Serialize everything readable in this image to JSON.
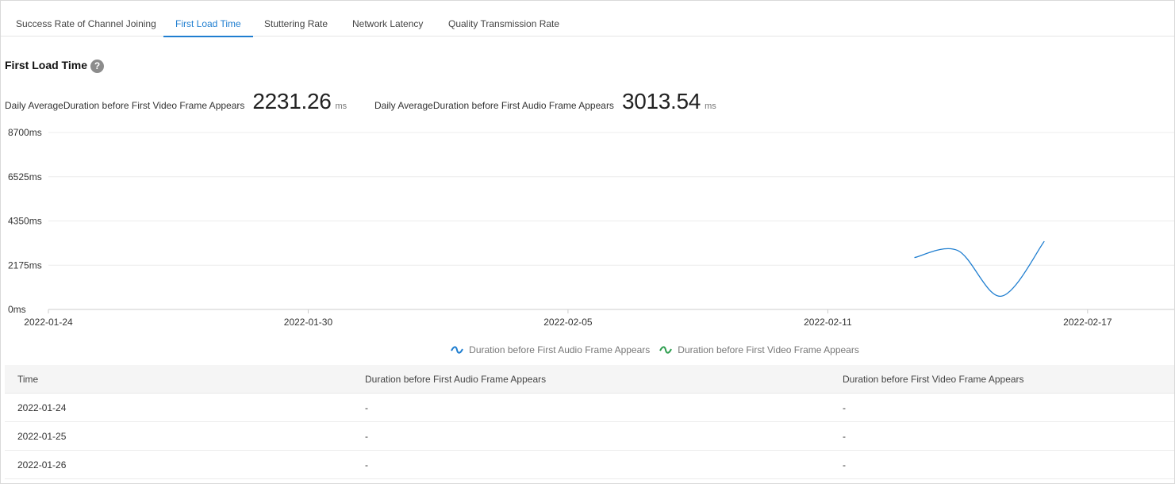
{
  "tabs": [
    {
      "label": "Success Rate of Channel Joining",
      "active": false
    },
    {
      "label": "First Load Time",
      "active": true
    },
    {
      "label": "Stuttering Rate",
      "active": false
    },
    {
      "label": "Network Latency",
      "active": false
    },
    {
      "label": "Quality Transmission Rate",
      "active": false
    }
  ],
  "section": {
    "title": "First Load Time",
    "help_icon": "question-circle-icon"
  },
  "metrics": {
    "video": {
      "label": "Daily AverageDuration before First Video Frame Appears",
      "value": "2231.26",
      "unit": "ms"
    },
    "audio": {
      "label": "Daily AverageDuration before First Audio Frame Appears",
      "value": "3013.54",
      "unit": "ms"
    }
  },
  "chart_data": {
    "type": "line",
    "y_ticks": [
      "0ms",
      "2175ms",
      "4350ms",
      "6525ms",
      "8700ms"
    ],
    "ylim": [
      0,
      8700
    ],
    "x_ticks": [
      "2022-01-24",
      "2022-01-30",
      "2022-02-05",
      "2022-02-11",
      "2022-02-17"
    ],
    "xlim": [
      "2022-01-24",
      "2022-02-19"
    ],
    "grid": true,
    "legend_position": "bottom",
    "series": [
      {
        "name": "Duration before First Audio Frame Appears",
        "color": "#1f7ed0",
        "points": [
          {
            "x": "2022-02-13",
            "y": 2550
          },
          {
            "x": "2022-02-14",
            "y": 2900
          },
          {
            "x": "2022-02-15",
            "y": 650
          },
          {
            "x": "2022-02-16",
            "y": 3350
          }
        ]
      },
      {
        "name": "Duration before First Video Frame Appears",
        "color": "#2e9e4f",
        "points": []
      }
    ]
  },
  "table": {
    "headers": [
      "Time",
      "Duration before First Audio Frame Appears",
      "Duration before First Video Frame Appears"
    ],
    "rows": [
      [
        "2022-01-24",
        "-",
        "-"
      ],
      [
        "2022-01-25",
        "-",
        "-"
      ],
      [
        "2022-01-26",
        "-",
        "-"
      ]
    ]
  }
}
